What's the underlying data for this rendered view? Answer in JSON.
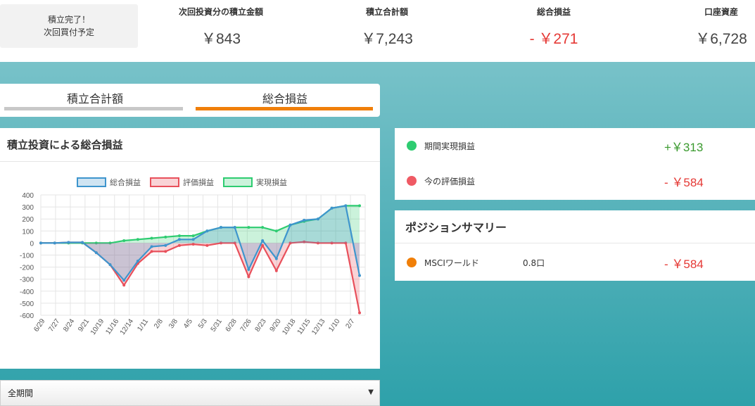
{
  "status": {
    "line1": "積立完了！",
    "line2": "次回買付予定"
  },
  "metrics": [
    {
      "label": "次回投資分の積立金額",
      "value": "￥843",
      "negative": false
    },
    {
      "label": "積立合計額",
      "value": "￥7,243",
      "negative": false
    },
    {
      "label": "総合損益",
      "value": "- ￥271",
      "negative": true
    },
    {
      "label": "口座資産",
      "value": "￥6,728",
      "negative": false
    }
  ],
  "tabs": [
    {
      "label": "積立合計額",
      "active": false
    },
    {
      "label": "総合損益",
      "active": true
    }
  ],
  "chart_card": {
    "title": "積立投資による総合損益"
  },
  "chart_data": {
    "type": "line",
    "legend": [
      "総合損益",
      "評価損益",
      "実現損益"
    ],
    "legend_position": "top",
    "grid": true,
    "ylim": [
      -600,
      400
    ],
    "yticks": [
      "400",
      "300",
      "200",
      "100",
      "0",
      "-100",
      "-200",
      "-300",
      "-400",
      "-500",
      "-600"
    ],
    "xticks": [
      "6/29",
      "7/27",
      "8/24",
      "9/21",
      "10/19",
      "11/16",
      "12/14",
      "1/11",
      "2/8",
      "3/8",
      "4/5",
      "5/3",
      "5/31",
      "6/28",
      "7/26",
      "8/23",
      "9/20",
      "10/18",
      "11/15",
      "12/13",
      "1/10",
      "2/7"
    ],
    "colors": {
      "total": "#3e95cd",
      "unrealized": "#e8505b",
      "realized": "#2ecc71"
    },
    "series": [
      {
        "name": "総合損益",
        "values": [
          0,
          0,
          5,
          5,
          -80,
          -180,
          -310,
          -150,
          -30,
          -20,
          30,
          30,
          100,
          130,
          130,
          -220,
          20,
          -130,
          150,
          190,
          200,
          290,
          310,
          -270
        ]
      },
      {
        "name": "評価損益",
        "values": [
          0,
          0,
          5,
          5,
          -80,
          -180,
          -350,
          -170,
          -70,
          -70,
          -20,
          -10,
          -20,
          0,
          0,
          -280,
          -20,
          -230,
          0,
          10,
          0,
          0,
          0,
          -580
        ]
      },
      {
        "name": "実現損益",
        "values": [
          0,
          0,
          0,
          0,
          0,
          0,
          20,
          30,
          40,
          50,
          60,
          60,
          100,
          130,
          130,
          130,
          130,
          100,
          150,
          180,
          200,
          290,
          310,
          310
        ]
      }
    ]
  },
  "period_select": {
    "value": "全期間"
  },
  "pl": {
    "realized": {
      "label": "期間実現損益",
      "value": "+￥313",
      "color": "#2ecc71"
    },
    "unrealized": {
      "label": "今の評価損益",
      "value": "- ￥584",
      "color": "#ef5a64"
    }
  },
  "summary": {
    "title": "ポジションサマリー",
    "items": [
      {
        "name": "MSCIワールド",
        "qty": "0.8口",
        "value": "- ￥584",
        "color": "#f07f09"
      }
    ]
  }
}
